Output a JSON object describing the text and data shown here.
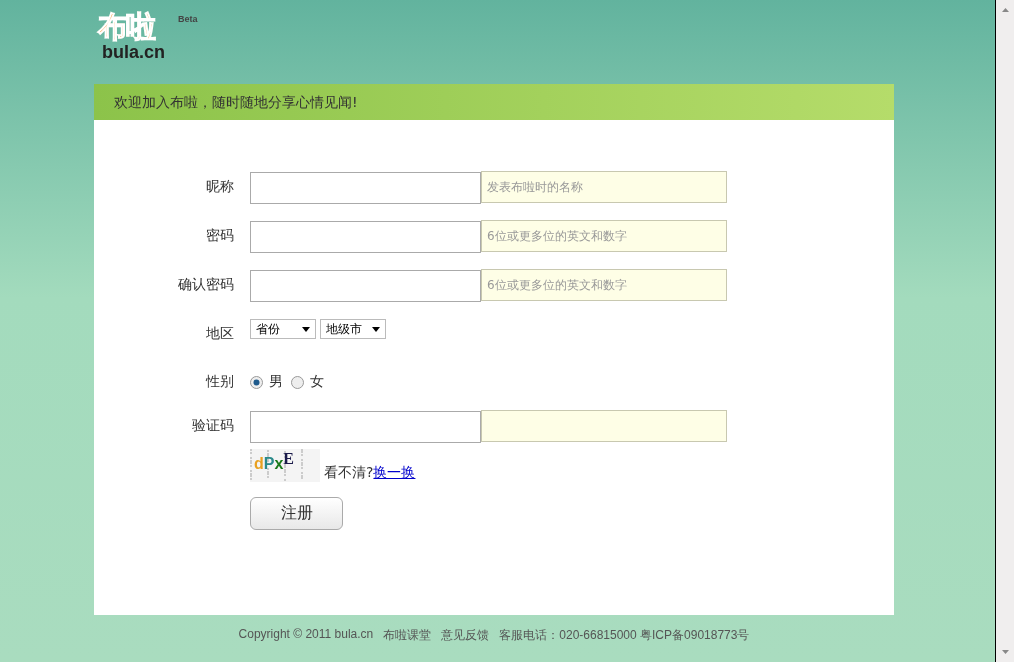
{
  "logo": {
    "name": "布啦",
    "domain": "bula.cn",
    "badge": "Beta"
  },
  "banner": "欢迎加入布啦，随时随地分享心情见闻!",
  "fields": [
    {
      "kind": "text",
      "label": "昵称",
      "hint": "发表布啦时的名称"
    },
    {
      "kind": "text",
      "label": "密码",
      "hint": "6位或更多位的英文和数字"
    },
    {
      "kind": "text",
      "label": "确认密码",
      "hint": "6位或更多位的英文和数字"
    },
    {
      "kind": "select",
      "label": "地区",
      "selects": [
        "省份",
        "地级市"
      ]
    },
    {
      "kind": "radio",
      "label": "性别",
      "options": [
        {
          "label": "男",
          "selected": true
        },
        {
          "label": "女",
          "selected": false
        }
      ]
    },
    {
      "kind": "captcha",
      "label": "验证码",
      "code": "dPxE",
      "prompt": "看不清?",
      "refresh": "换一换"
    }
  ],
  "submit": "注册",
  "footer": [
    "Copyright © 2011 bula.cn",
    "布啦课堂",
    "意见反馈",
    "客服电话：020-66815000 粤ICP备09018773号"
  ]
}
